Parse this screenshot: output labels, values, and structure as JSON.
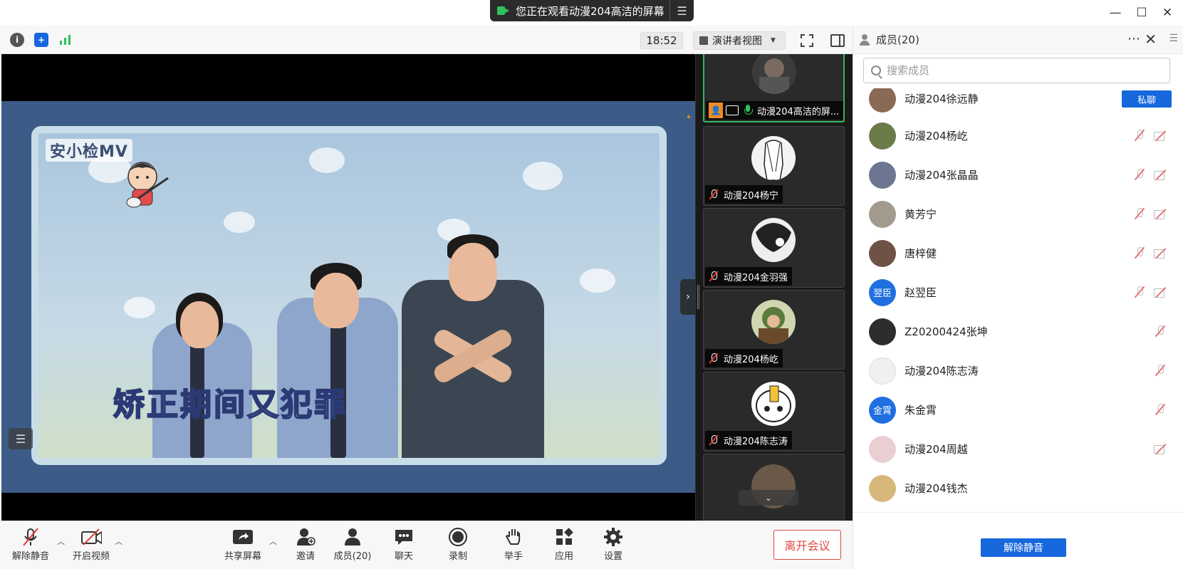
{
  "title_bar": {
    "share_banner_text": "您正在观看动漫204高洁的屏幕",
    "share_menu_icon": "list-icon",
    "window_controls": [
      "minimize-icon",
      "maximize-icon",
      "close-icon"
    ]
  },
  "toolbar": {
    "icons": [
      "info-icon",
      "shield-icon",
      "signal-icon"
    ],
    "time": "18:52",
    "view_label": "演讲者视图",
    "view_caret_icon": "caret-down-icon",
    "fullscreen_icon": "fullscreen-icon",
    "panel_toggle_icon": "side-panel-icon"
  },
  "main_video": {
    "watermark": "安小检MV",
    "caption": "矫正期间又犯罪"
  },
  "thumbnails": [
    {
      "name": "动漫204高洁的屏...",
      "active": true,
      "mic": "on"
    },
    {
      "name": "动漫204杨宁",
      "active": false,
      "mic": "muted"
    },
    {
      "name": "动漫204金羽强",
      "active": false,
      "mic": "muted"
    },
    {
      "name": "动漫204杨屹",
      "active": false,
      "mic": "muted"
    },
    {
      "name": "动漫204陈志涛",
      "active": false,
      "mic": "muted"
    }
  ],
  "members_panel": {
    "title": "成员(20)",
    "search_placeholder": "搜索成员",
    "private_chat_label": "私聊",
    "unmute_all_label": "解除静音",
    "members": [
      {
        "name": "动漫204徐远静",
        "avatar_text": "",
        "avatar_color": "#8a6a55",
        "mic_muted": false,
        "cam_off": false,
        "dm": true
      },
      {
        "name": "动漫204杨屹",
        "avatar_text": "",
        "avatar_color": "#6b7b4a",
        "mic_muted": true,
        "cam_off": true,
        "dm": false
      },
      {
        "name": "动漫204张晶晶",
        "avatar_text": "",
        "avatar_color": "#6d7690",
        "mic_muted": true,
        "cam_off": true,
        "dm": false
      },
      {
        "name": "黄芳宁",
        "avatar_text": "",
        "avatar_color": "#a39a8e",
        "mic_muted": true,
        "cam_off": true,
        "dm": false
      },
      {
        "name": "唐梓健",
        "avatar_text": "",
        "avatar_color": "#6e5246",
        "mic_muted": true,
        "cam_off": true,
        "dm": false
      },
      {
        "name": "赵翌臣",
        "avatar_text": "翌臣",
        "avatar_color": "#1f6fe0",
        "mic_muted": true,
        "cam_off": true,
        "dm": false
      },
      {
        "name": "Z20200424张坤",
        "avatar_text": "",
        "avatar_color": "#2d2d2d",
        "mic_muted": true,
        "cam_off": false,
        "dm": false
      },
      {
        "name": "动漫204陈志涛",
        "avatar_text": "",
        "avatar_color": "#f0f0f0",
        "mic_muted": true,
        "cam_off": false,
        "dm": false
      },
      {
        "name": "朱金霄",
        "avatar_text": "金霄",
        "avatar_color": "#1f6fe0",
        "mic_muted": true,
        "cam_off": false,
        "dm": false
      },
      {
        "name": "动漫204周越",
        "avatar_text": "",
        "avatar_color": "#e9cfd2",
        "mic_muted": false,
        "cam_off": true,
        "dm": false
      },
      {
        "name": "动漫204钱杰",
        "avatar_text": "",
        "avatar_color": "#d8b77a",
        "mic_muted": false,
        "cam_off": false,
        "dm": false
      }
    ]
  },
  "bottom_bar": {
    "buttons": [
      {
        "label": "解除静音",
        "icon": "mic-muted-icon"
      },
      {
        "label": "开启视频",
        "icon": "camera-off-icon"
      },
      {
        "label": "共享屏幕",
        "icon": "share-screen-icon"
      },
      {
        "label": "邀请",
        "icon": "invite-icon"
      },
      {
        "label": "成员(20)",
        "icon": "members-icon"
      },
      {
        "label": "聊天",
        "icon": "chat-icon"
      },
      {
        "label": "录制",
        "icon": "record-icon"
      },
      {
        "label": "举手",
        "icon": "raise-hand-icon"
      },
      {
        "label": "应用",
        "icon": "apps-icon"
      },
      {
        "label": "设置",
        "icon": "settings-icon"
      }
    ],
    "leave_label": "离开会议"
  }
}
